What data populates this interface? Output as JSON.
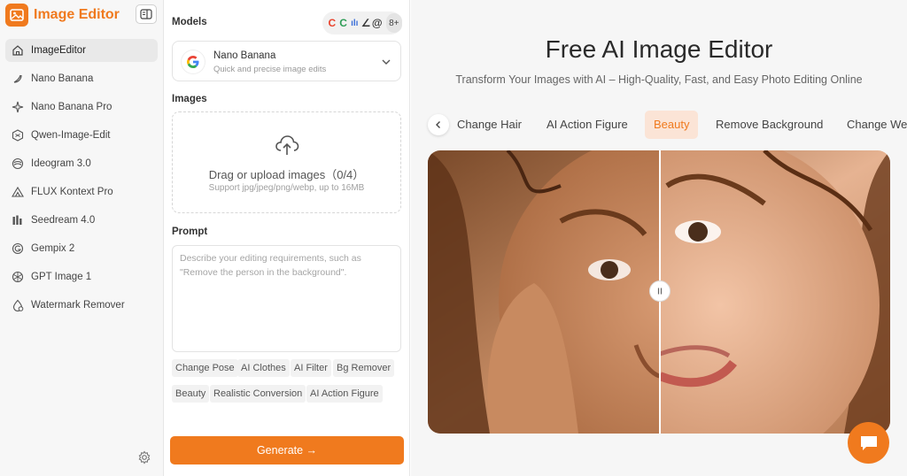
{
  "sidebar": {
    "brand": "Image Editor",
    "items": [
      {
        "label": "ImageEditor",
        "icon": "home-icon",
        "active": true
      },
      {
        "label": "Nano Banana",
        "icon": "banana-icon"
      },
      {
        "label": "Nano Banana Pro",
        "icon": "sparkle-icon"
      },
      {
        "label": "Qwen-Image-Edit",
        "icon": "qwen-icon"
      },
      {
        "label": "Ideogram 3.0",
        "icon": "ideogram-icon"
      },
      {
        "label": "FLUX Kontext Pro",
        "icon": "flux-icon"
      },
      {
        "label": "Seedream 4.0",
        "icon": "bars-icon"
      },
      {
        "label": "Gempix 2",
        "icon": "gempix-icon"
      },
      {
        "label": "GPT Image 1",
        "icon": "openai-icon"
      },
      {
        "label": "Watermark Remover",
        "icon": "watermark-icon"
      }
    ]
  },
  "panel": {
    "models_title": "Models",
    "more_models": "8+",
    "selected_model": {
      "name": "Nano Banana",
      "description": "Quick and precise image edits"
    },
    "images_title": "Images",
    "upload": {
      "text": "Drag or upload images（0/4）",
      "hint": "Support jpg/jpeg/png/webp, up to 16MB"
    },
    "prompt_title": "Prompt",
    "prompt_placeholder": "Describe your editing requirements, such as \"Remove the person in the background\".",
    "chips": [
      "Change Pose",
      "AI Clothes",
      "AI Filter",
      "Bg Remover",
      "Beauty",
      "Realistic Conversion",
      "AI Action Figure"
    ],
    "generate_label": "Generate →"
  },
  "main": {
    "title": "Free AI Image Editor",
    "subtitle": "Transform Your Images with AI – High-Quality, Fast, and Easy Photo Editing Online",
    "tabs": [
      {
        "label": "Change Hair"
      },
      {
        "label": "AI Action Figure"
      },
      {
        "label": "Beauty",
        "active": true
      },
      {
        "label": "Remove Background"
      },
      {
        "label": "Change Wea"
      }
    ]
  },
  "colors": {
    "accent": "#f07a1e",
    "active_tab_bg": "#fbe4d6"
  }
}
